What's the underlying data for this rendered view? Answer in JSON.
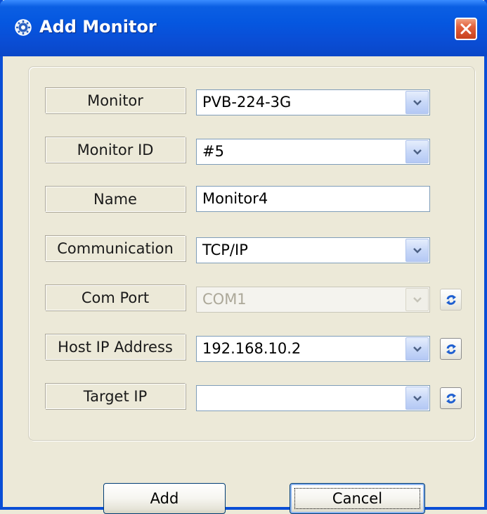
{
  "window": {
    "title": "Add Monitor",
    "icon": "gear-icon",
    "close_icon": "close-icon"
  },
  "form": {
    "monitor": {
      "label": "Monitor",
      "value": "PVB-224-3G"
    },
    "monitor_id": {
      "label": "Monitor ID",
      "value": "#5"
    },
    "name": {
      "label": "Name",
      "value": "Monitor4"
    },
    "communication": {
      "label": "Communication",
      "value": "TCP/IP"
    },
    "com_port": {
      "label": "Com Port",
      "value": "COM1",
      "disabled": true
    },
    "host_ip": {
      "label": "Host IP Address",
      "value": "192.168.10.2"
    },
    "target_ip": {
      "label": "Target IP",
      "value": ""
    }
  },
  "buttons": {
    "add": "Add",
    "cancel": "Cancel"
  },
  "colors": {
    "titlebar": "#0A4ED6",
    "dialog_bg": "#ECE9D8",
    "close_button": "#E2603C",
    "refresh_icon": "#1E5FD0"
  }
}
